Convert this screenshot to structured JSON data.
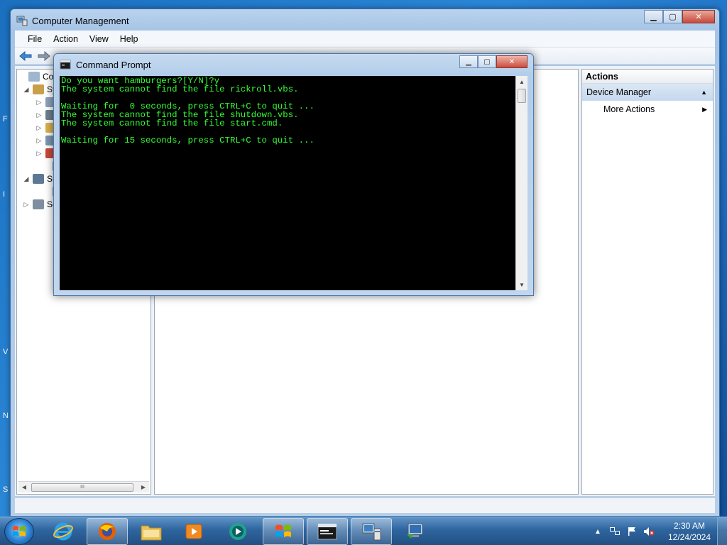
{
  "desktop": {
    "edge_letters": [
      "F",
      "I",
      "V",
      "N",
      "S"
    ]
  },
  "computer_management": {
    "title": "Computer Management",
    "menu": [
      "File",
      "Action",
      "View",
      "Help"
    ],
    "tree": [
      {
        "label": "Comp",
        "expander": ""
      },
      {
        "label": "Sy",
        "expander": "◢"
      },
      {
        "label": "",
        "expander": "▷"
      },
      {
        "label": "",
        "expander": "▷"
      },
      {
        "label": "",
        "expander": "▷"
      },
      {
        "label": "",
        "expander": "▷"
      },
      {
        "label": "",
        "expander": "▷"
      },
      {
        "label": "",
        "expander": ""
      },
      {
        "label": "St",
        "expander": "◢"
      },
      {
        "label": "",
        "expander": ""
      },
      {
        "label": "Se",
        "expander": "▷"
      }
    ],
    "tree_scroll_thumb": "III",
    "actions": {
      "header": "Actions",
      "section": "Device Manager",
      "item": "More Actions"
    }
  },
  "command_prompt": {
    "title": "Command Prompt",
    "lines": [
      "Do you want hamburgers?[Y/N]?y",
      "The system cannot find the file rickroll.vbs.",
      "",
      "Waiting for  0 seconds, press CTRL+C to quit ...",
      "The system cannot find the file shutdown.vbs.",
      "The system cannot find the file start.cmd.",
      "",
      "Waiting for 15 seconds, press CTRL+C to quit ..."
    ],
    "colors": {
      "text": "#33ff33",
      "background": "#000000"
    }
  },
  "taskbar": {
    "items": [
      {
        "name": "internet-explorer",
        "active": false
      },
      {
        "name": "firefox",
        "active": true
      },
      {
        "name": "file-explorer",
        "active": false
      },
      {
        "name": "media-player",
        "active": false
      },
      {
        "name": "media-center",
        "active": false
      },
      {
        "name": "windows-explorer",
        "active": false
      },
      {
        "name": "command-prompt",
        "active": true
      },
      {
        "name": "computer-management",
        "active": false
      },
      {
        "name": "remote-desktop",
        "active": false
      }
    ],
    "clock": {
      "time": "2:30 AM",
      "date": "12/24/2024"
    }
  }
}
